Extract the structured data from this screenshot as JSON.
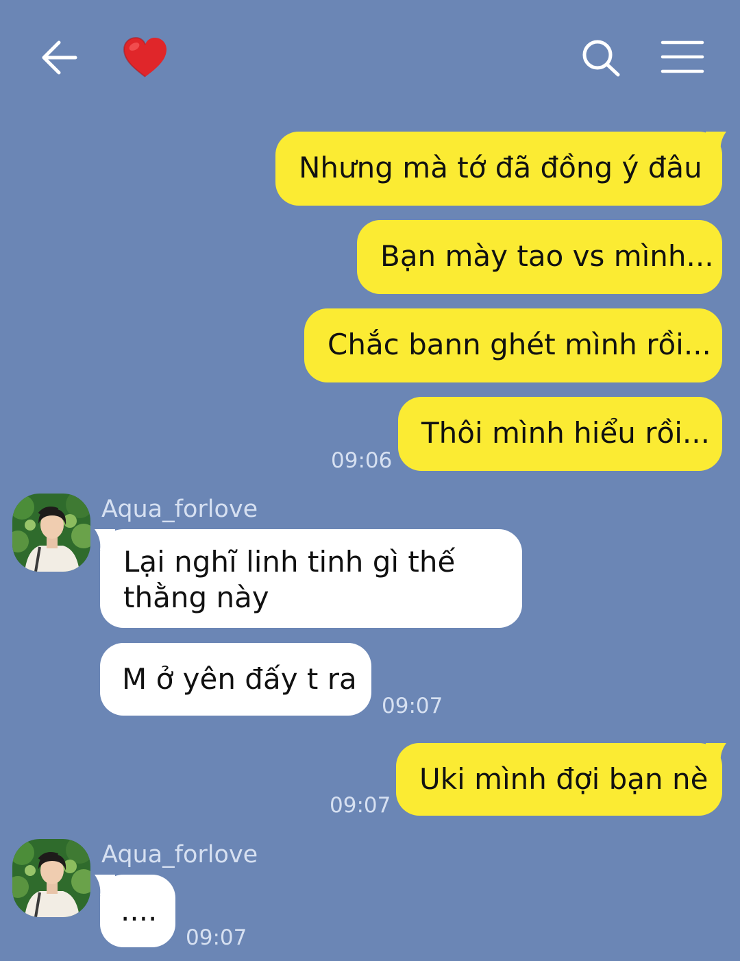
{
  "header": {
    "back_icon": "arrow-left-icon",
    "title_icon": "red-heart-emoji",
    "search_icon": "search-icon",
    "menu_icon": "hamburger-menu-icon"
  },
  "colors": {
    "background": "#6b86b5",
    "sent_bubble": "#fbeb33",
    "received_bubble": "#ffffff",
    "meta_text": "#d6e0f1"
  },
  "messages": [
    {
      "from": "me",
      "text": "Nhưng mà tớ đã đồng ý đâu"
    },
    {
      "from": "me",
      "text": "Bạn mày tao vs mình..."
    },
    {
      "from": "me",
      "text": "Chắc bann ghét mình rồi..."
    },
    {
      "from": "me",
      "text": "Thôi mình hiểu rồi...",
      "time": "09:06"
    },
    {
      "from": "Aqua_forlove",
      "sender": "Aqua_forlove",
      "text": "Lại nghĩ linh tinh gì thế thằng này"
    },
    {
      "from": "Aqua_forlove",
      "text": "M ở yên đấy t ra",
      "time": "09:07"
    },
    {
      "from": "me",
      "text": "Uki mình đợi bạn nè",
      "time": "09:07"
    },
    {
      "from": "Aqua_forlove",
      "sender": "Aqua_forlove",
      "text": "....",
      "time": "09:07"
    }
  ]
}
